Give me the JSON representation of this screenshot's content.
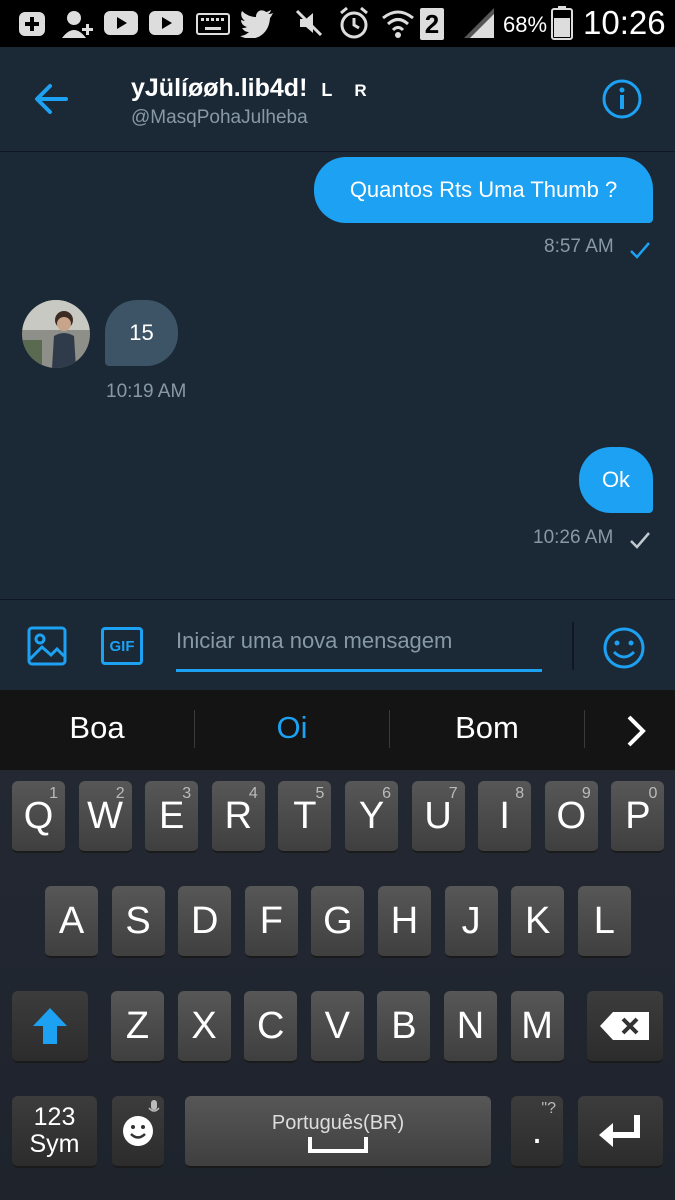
{
  "status_bar": {
    "battery_percent": "68%",
    "time": "10:26",
    "sim_badge": "2"
  },
  "header": {
    "name": "yJülíøøh.lib4d!",
    "tag_l": "L",
    "tag_r": "R",
    "handle": "@MasqPohaJulheba"
  },
  "messages": [
    {
      "side": "out",
      "text": "Quantos Rts Uma Thumb ?",
      "time": "8:57 AM"
    },
    {
      "side": "in",
      "text": "15",
      "time": "10:19 AM"
    },
    {
      "side": "out",
      "text": "Ok",
      "time": "10:26 AM"
    }
  ],
  "composer": {
    "placeholder": "Iniciar uma nova mensagem",
    "gif_label": "GIF"
  },
  "suggestions": [
    "Boa",
    "Oi",
    "Bom"
  ],
  "keyboard": {
    "row1": [
      {
        "k": "Q",
        "h": "1"
      },
      {
        "k": "W",
        "h": "2"
      },
      {
        "k": "E",
        "h": "3"
      },
      {
        "k": "R",
        "h": "4"
      },
      {
        "k": "T",
        "h": "5"
      },
      {
        "k": "Y",
        "h": "6"
      },
      {
        "k": "U",
        "h": "7"
      },
      {
        "k": "I",
        "h": "8"
      },
      {
        "k": "O",
        "h": "9"
      },
      {
        "k": "P",
        "h": "0"
      }
    ],
    "row2": [
      "A",
      "S",
      "D",
      "F",
      "G",
      "H",
      "J",
      "K",
      "L"
    ],
    "row3": [
      "Z",
      "X",
      "C",
      "V",
      "B",
      "N",
      "M"
    ],
    "sym_line1": "123",
    "sym_line2": "Sym",
    "space_label": "Português(BR)",
    "period_label": ".",
    "period_hint": "\"?"
  },
  "colors": {
    "accent": "#1da1f2",
    "background": "#1b2836",
    "incoming_bubble": "#3d5466",
    "muted_text": "#8899a6"
  }
}
